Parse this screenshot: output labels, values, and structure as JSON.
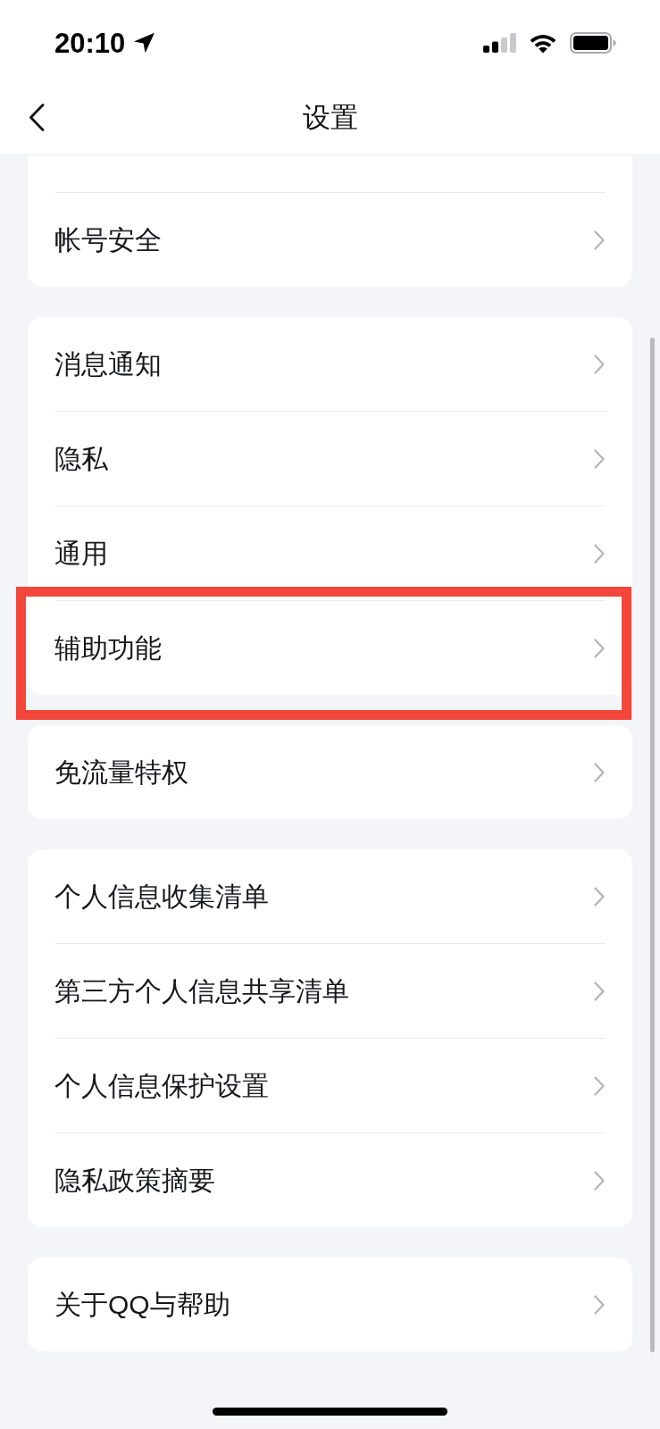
{
  "status_bar": {
    "time": "20:10"
  },
  "nav_bar": {
    "title": "设置"
  },
  "groups": [
    {
      "items": [
        {
          "label": "帐号安全",
          "highlighted": false
        }
      ]
    },
    {
      "items": [
        {
          "label": "消息通知",
          "highlighted": false
        },
        {
          "label": "隐私",
          "highlighted": false
        },
        {
          "label": "通用",
          "highlighted": false
        },
        {
          "label": "辅助功能",
          "highlighted": true
        }
      ]
    },
    {
      "items": [
        {
          "label": "免流量特权",
          "highlighted": false
        }
      ]
    },
    {
      "items": [
        {
          "label": "个人信息收集清单",
          "highlighted": false
        },
        {
          "label": "第三方个人信息共享清单",
          "highlighted": false
        },
        {
          "label": "个人信息保护设置",
          "highlighted": false
        },
        {
          "label": "隐私政策摘要",
          "highlighted": false
        }
      ]
    },
    {
      "items": [
        {
          "label": "关于QQ与帮助",
          "highlighted": false
        }
      ]
    }
  ]
}
